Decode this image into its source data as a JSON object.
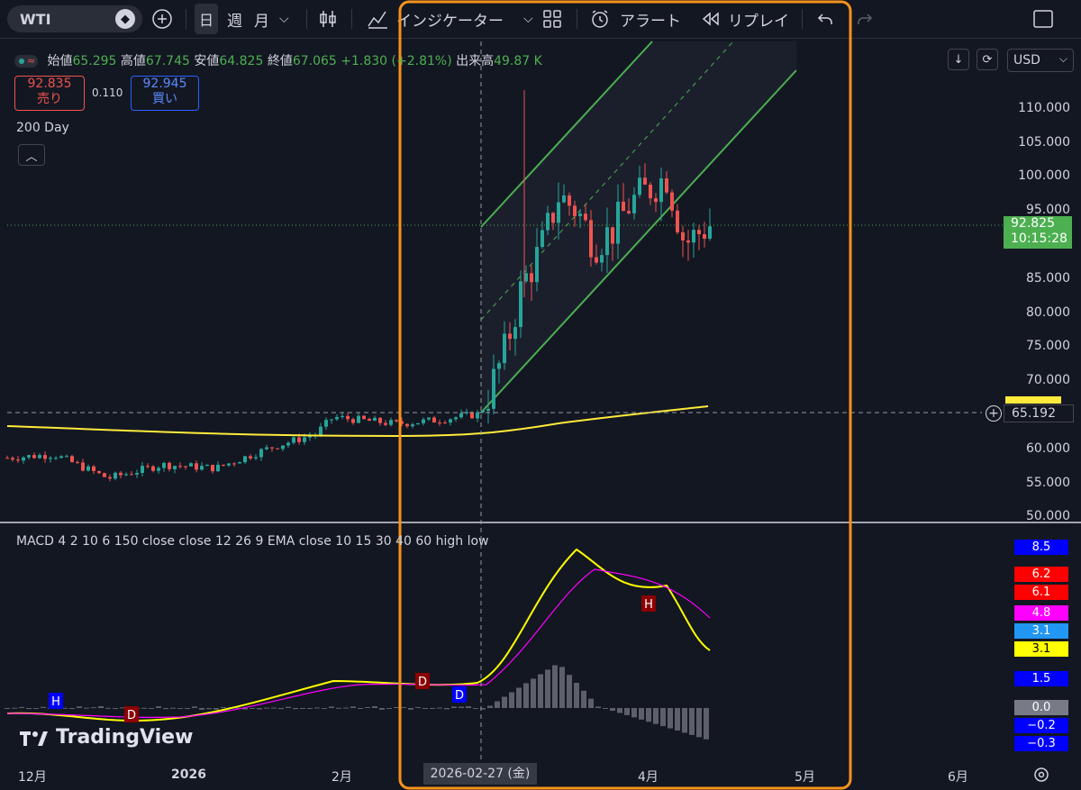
{
  "toolbar": {
    "symbol": "WTI",
    "day": "日",
    "week": "週",
    "month": "月",
    "indicators": "インジケーター",
    "alert": "アラート",
    "replay": "リプレイ"
  },
  "legend": {
    "open_label": "始値",
    "open": "65.295",
    "high_label": "高値",
    "high": "67.745",
    "low_label": "安値",
    "low": "64.825",
    "close_label": "終値",
    "close": "67.065",
    "change": "+1.830 (+2.81%)",
    "volume_label": "出来高",
    "volume": "49.87 K"
  },
  "order": {
    "sell_price": "92.835",
    "sell_label": "売り",
    "spread": "0.110",
    "buy_price": "92.945",
    "buy_label": "買い"
  },
  "ma_label": "200 Day",
  "currency": "USD",
  "price_axis": [
    "110.000",
    "105.000",
    "100.000",
    "95.000",
    "85.000",
    "80.000",
    "75.000",
    "70.000",
    "60.000",
    "55.000",
    "50.000"
  ],
  "current_price": "92.825",
  "countdown": "10:15:28",
  "crosshair_price": "65.192",
  "macd_label": "MACD 4 2 10 6 150 close close 12 26 9 EMA close 10 15 30 40 60 high low",
  "macd_axis": {
    "v1": "8.5",
    "v2": "6.2",
    "v3": "6.1",
    "v4": "4.8",
    "v5": "3.1",
    "v6": "3.1",
    "v7": "1.5",
    "v8": "0.0",
    "v9": "−0.2",
    "v10": "−0.3"
  },
  "time_axis": [
    "12月",
    "2026",
    "2月",
    "4月",
    "5月",
    "6月"
  ],
  "crosshair_date": "2026-02-27 (金)",
  "watermark": "TradingView",
  "markers": {
    "h": "H",
    "d": "D"
  },
  "colors": {
    "up": "#26a69a",
    "down": "#ef5350",
    "ma": "#ffeb3b",
    "channel": "#4caf50",
    "highlight": "#f7931a"
  }
}
